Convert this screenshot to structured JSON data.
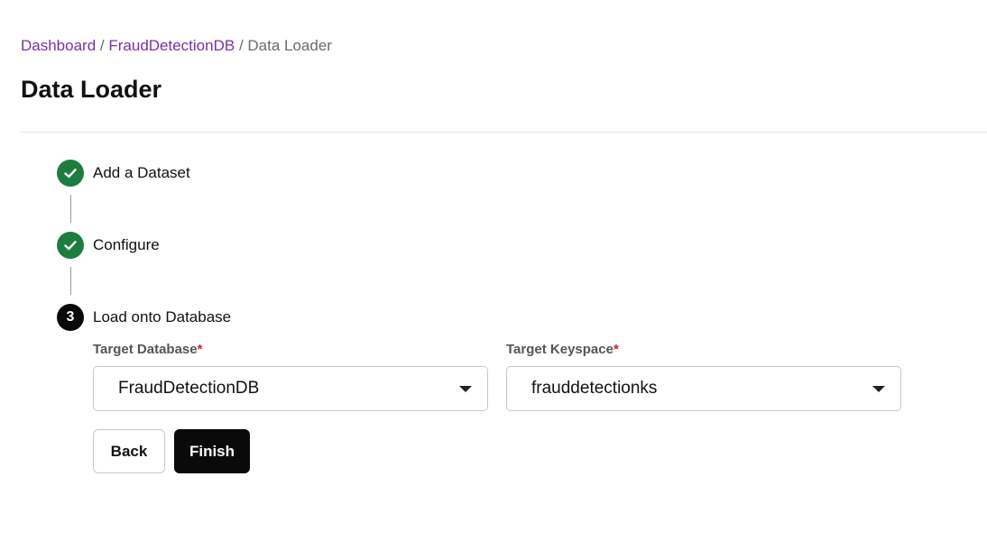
{
  "breadcrumb": {
    "items": [
      "Dashboard",
      "FraudDetectionDB"
    ],
    "separator": "/",
    "current": "Data Loader"
  },
  "page": {
    "title": "Data Loader"
  },
  "steps": [
    {
      "label": "Add a Dataset",
      "status": "complete",
      "icon": "check-icon"
    },
    {
      "label": "Configure",
      "status": "complete",
      "icon": "check-icon"
    },
    {
      "label": "Load onto Database",
      "status": "active",
      "number": "3"
    }
  ],
  "form": {
    "required_marker": "*",
    "target_database": {
      "label": "Target Database",
      "value": "FraudDetectionDB"
    },
    "target_keyspace": {
      "label": "Target Keyspace",
      "value": "frauddetectionks"
    }
  },
  "buttons": {
    "back": "Back",
    "finish": "Finish"
  },
  "colors": {
    "link": "#7b2fa8",
    "step_complete": "#1d7d3e",
    "step_active": "#0a0a0a",
    "required": "#c4262e",
    "primary_button": "#0a0a0a"
  }
}
